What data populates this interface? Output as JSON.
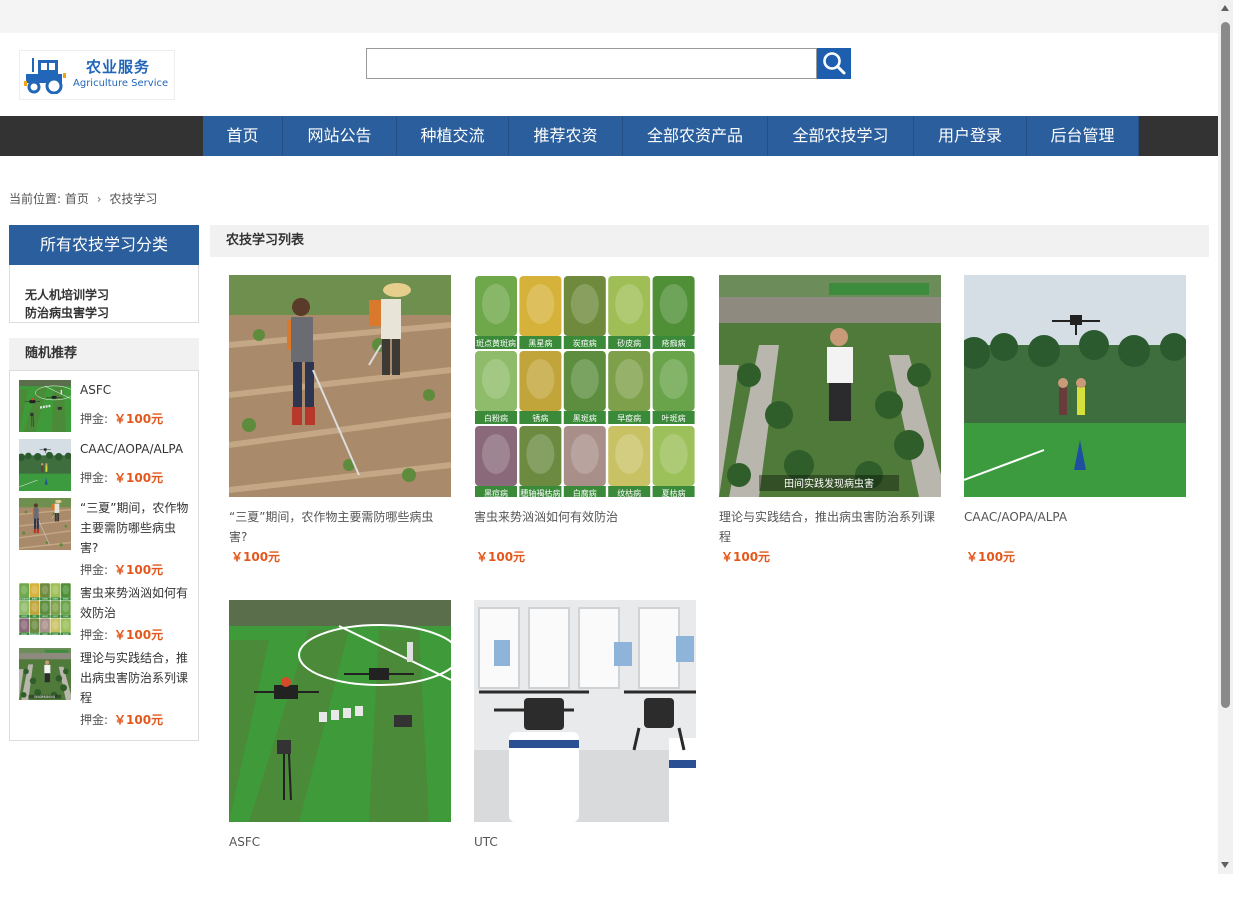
{
  "logo": {
    "cn": "农业服务",
    "en": "Agriculture Service"
  },
  "search": {
    "placeholder": "",
    "value": ""
  },
  "nav": [
    {
      "label": "首页",
      "w": 80
    },
    {
      "label": "网站公告",
      "w": 114
    },
    {
      "label": "种植交流",
      "w": 112
    },
    {
      "label": "推荐农资",
      "w": 114
    },
    {
      "label": "全部农资产品",
      "w": 145
    },
    {
      "label": "全部农技学习",
      "w": 146
    },
    {
      "label": "用户登录",
      "w": 113
    },
    {
      "label": "后台管理",
      "w": 112
    }
  ],
  "breadcrumb": {
    "prefix": "当前位置:",
    "home": "首页",
    "sep": "›",
    "current": "农技学习"
  },
  "categories": {
    "title": "所有农技学习分类",
    "items": [
      "无人机培训学习",
      "防治病虫害学习"
    ]
  },
  "recommend": {
    "title": "随机推荐",
    "deposit_label": "押金:",
    "items": [
      {
        "title": "ASFC",
        "price": "￥100元",
        "thumb": "drone-field"
      },
      {
        "title": "CAAC/AOPA/ALPA",
        "price": "￥100元",
        "thumb": "drone-sky"
      },
      {
        "title": "“三夏”期间，农作物主要需防哪些病虫害?",
        "price": "￥100元",
        "thumb": "farmers"
      },
      {
        "title": "害虫来势汹汹如何有效防治",
        "price": "￥100元",
        "thumb": "leaves"
      },
      {
        "title": "理论与实践结合，推出病虫害防治系列课程",
        "price": "￥100元",
        "thumb": "man-field"
      }
    ]
  },
  "main": {
    "title": "农技学习列表",
    "cards": [
      {
        "title": "“三夏”期间，农作物主要需防哪些病虫害?",
        "price": "￥100元",
        "thumb": "farmers"
      },
      {
        "title": "害虫来势汹汹如何有效防治",
        "price": "￥100元",
        "thumb": "leaves"
      },
      {
        "title": "理论与实践结合，推出病虫害防治系列课程",
        "price": "￥100元",
        "thumb": "man-field"
      },
      {
        "title": "CAAC/AOPA/ALPA",
        "price": "￥100元",
        "thumb": "drone-sky"
      },
      {
        "title": "ASFC",
        "price": "",
        "thumb": "drone-field"
      },
      {
        "title": "UTC",
        "price": "",
        "thumb": "drone-lab"
      }
    ]
  },
  "leaf_labels": [
    "斑点黄斑病",
    "黑星病",
    "炭疽病",
    "砂皮病",
    "疮痂病",
    "白粉病",
    "锈病",
    "黑斑病",
    "早疫病",
    "叶斑病",
    "黑痘病",
    "穗轴褐枯病",
    "白腐病",
    "纹枯病",
    "夏枯病"
  ],
  "video_caption": "田间实践发现病虫害",
  "colors": {
    "accent": "#2b5e9c",
    "price": "#e4571c",
    "nav_bg": "#333333"
  }
}
